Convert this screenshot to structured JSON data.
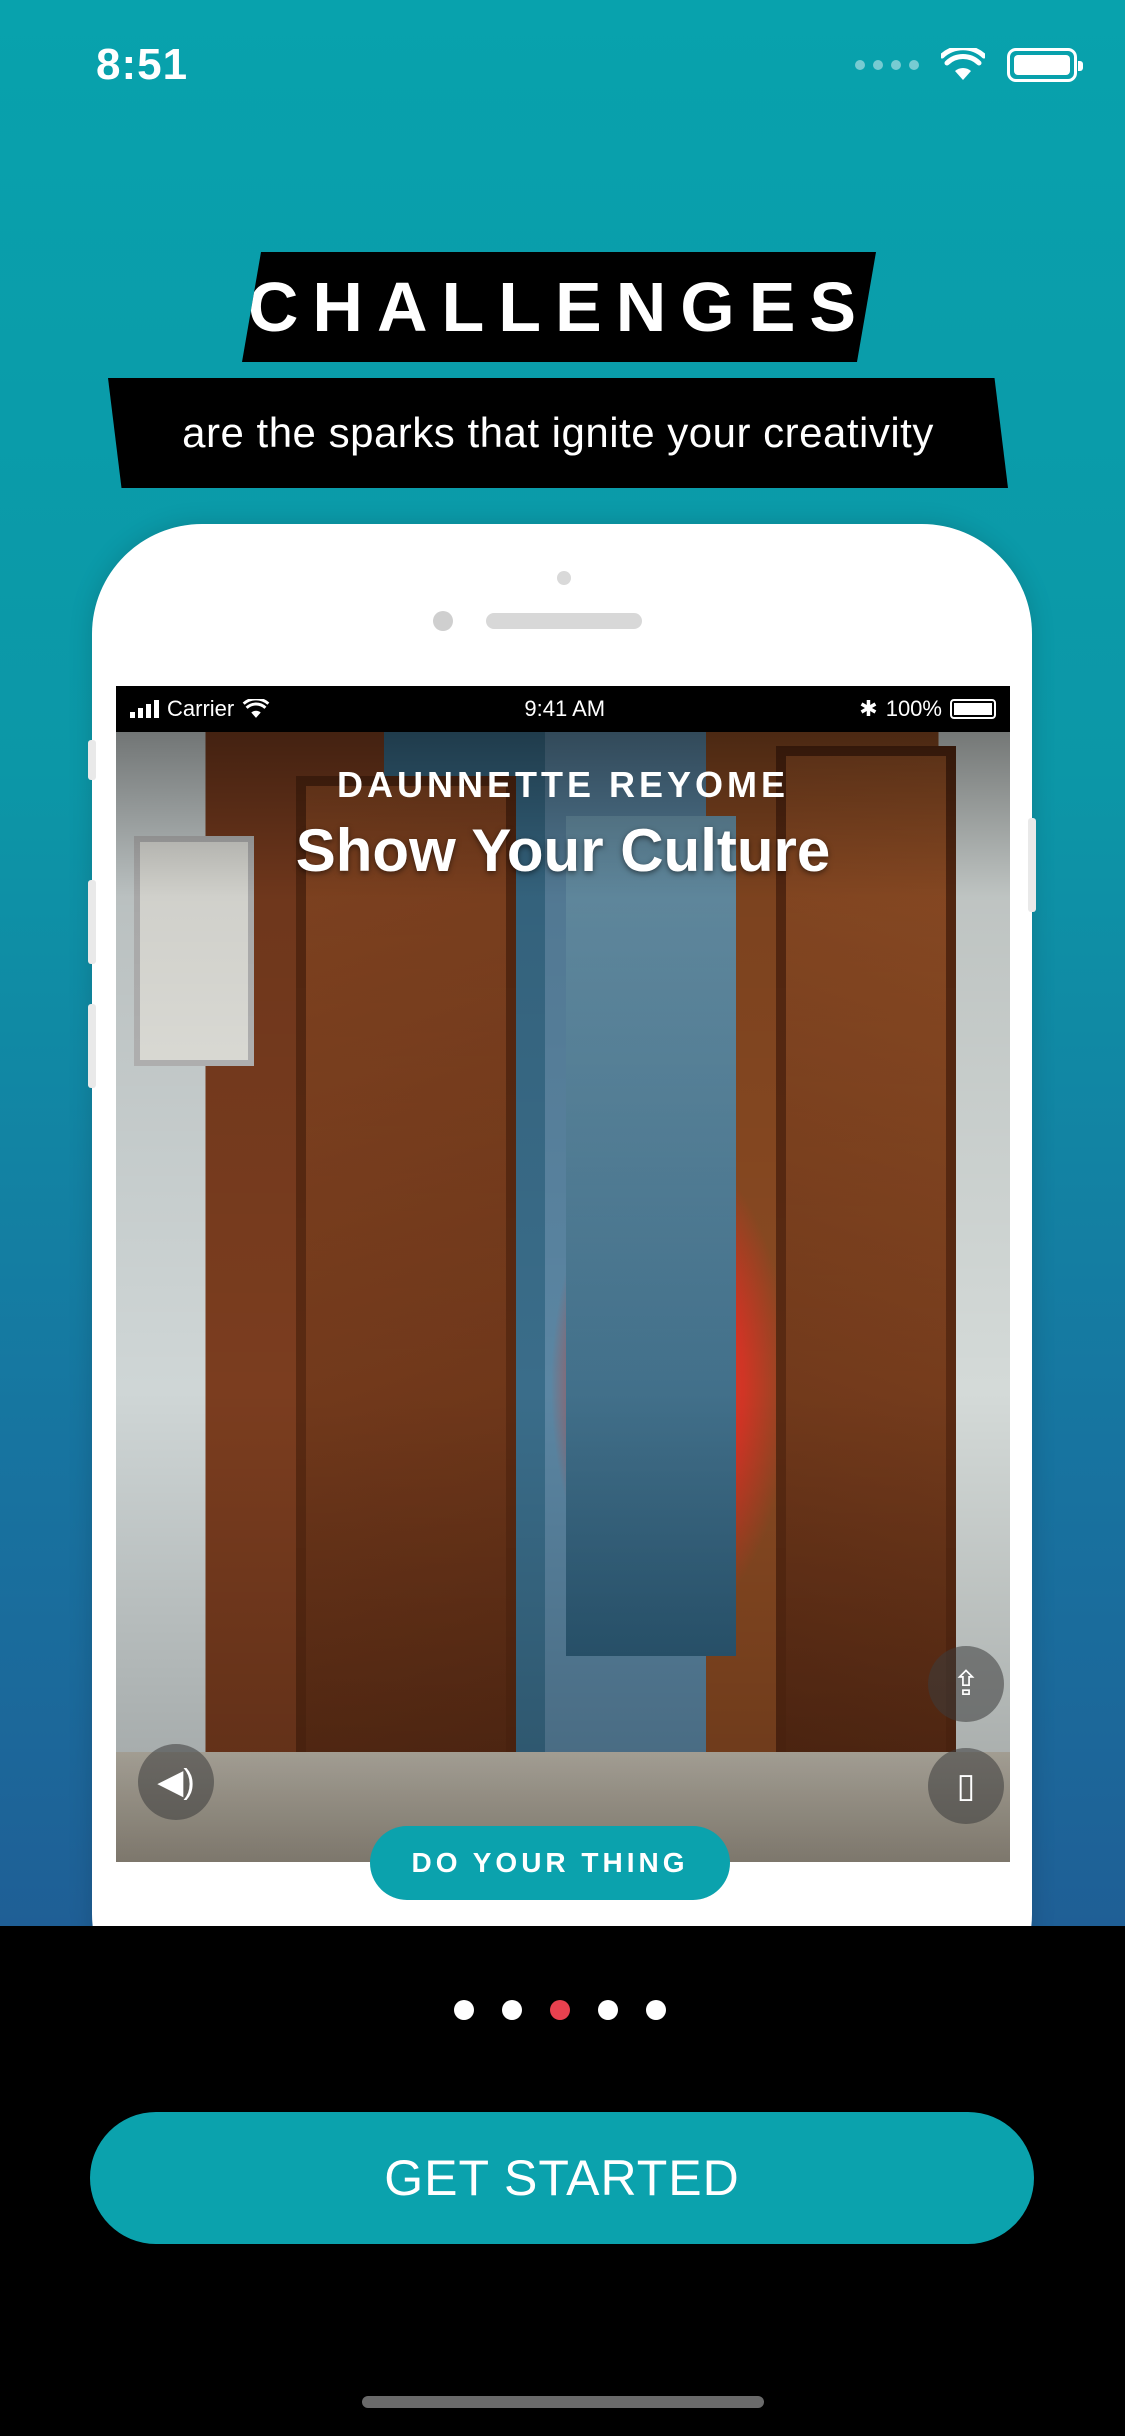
{
  "status_bar": {
    "time": "8:51"
  },
  "headline": {
    "title": "CHALLENGES",
    "subtitle": "are the sparks that ignite your creativity"
  },
  "mockup": {
    "inner_status": {
      "carrier": "Carrier",
      "time": "9:41 AM",
      "battery": "100%"
    },
    "author": "DAUNNETTE REYOME",
    "challenge_title": "Show Your Culture",
    "icons": [
      "volume-icon",
      "share-icon",
      "bookmark-icon"
    ],
    "cta_label": "DO YOUR THING"
  },
  "pager": {
    "count": 5,
    "active_index": 2,
    "active_color": "#e8414f"
  },
  "cta": {
    "label": "GET STARTED",
    "color": "#0ba2ad"
  },
  "colors": {
    "accent": "#0ba2ad",
    "background_top": "#08a2ad",
    "background_bottom": "#000000"
  }
}
